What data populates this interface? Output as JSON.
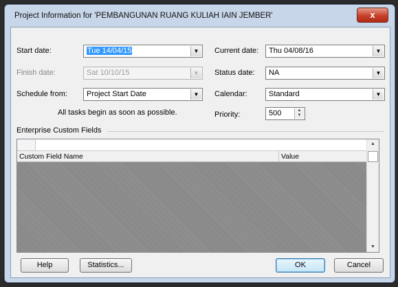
{
  "window": {
    "title": "Project Information for 'PEMBANGUNAN RUANG KULIAH IAIN JEMBER'",
    "close_label": "x"
  },
  "fields": {
    "start_date": {
      "label": "Start date:",
      "value": "Tue 14/04/15"
    },
    "finish_date": {
      "label": "Finish date:",
      "value": "Sat 10/10/15"
    },
    "schedule_from": {
      "label": "Schedule from:",
      "value": "Project Start Date"
    },
    "schedule_note": "All tasks begin as soon as possible.",
    "current_date": {
      "label": "Current date:",
      "value": "Thu 04/08/16"
    },
    "status_date": {
      "label": "Status date:",
      "value": "NA"
    },
    "calendar": {
      "label": "Calendar:",
      "value": "Standard"
    },
    "priority": {
      "label": "Priority:",
      "value": "500"
    }
  },
  "enterprise": {
    "heading": "Enterprise Custom Fields",
    "columns": [
      "Custom Field Name",
      "Value"
    ]
  },
  "buttons": {
    "help": "Help",
    "statistics": "Statistics...",
    "ok": "OK",
    "cancel": "Cancel"
  },
  "icons": {
    "dropdown": "chevron-down-icon",
    "spin_up": "spin-up-icon",
    "spin_down": "spin-down-icon",
    "close": "close-icon"
  }
}
